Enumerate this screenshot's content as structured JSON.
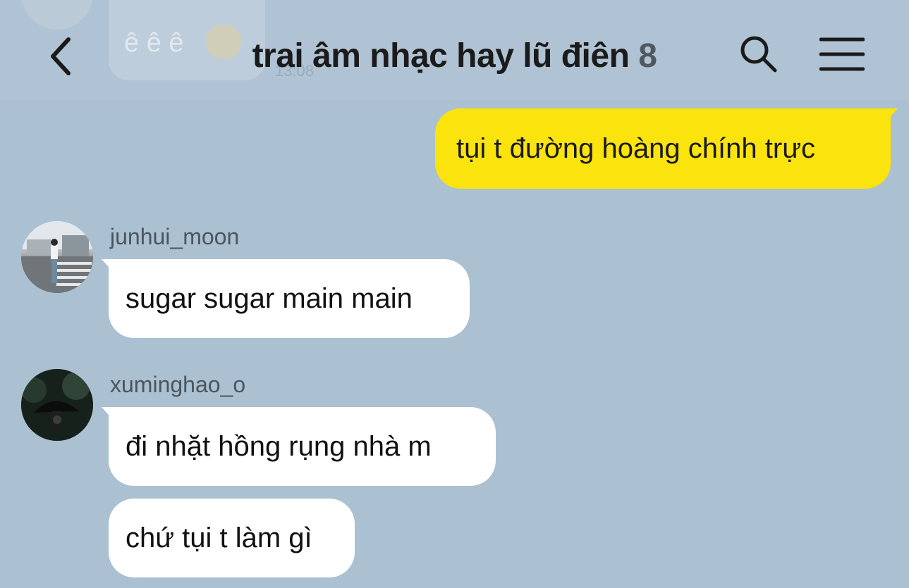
{
  "header": {
    "title": "trai âm nhạc hay lũ điên",
    "member_count": "8",
    "ghost_text": "ê ê ê",
    "ghost_time": "13:08"
  },
  "messages": [
    {
      "id": "m1",
      "side": "mine",
      "text": "tụi t đường hoàng chính trực"
    },
    {
      "id": "m2",
      "side": "other",
      "sender": "junhui_moon",
      "text": "sugar sugar main main"
    },
    {
      "id": "m3",
      "side": "other",
      "sender": "xuminghao_o",
      "text": "đi nhặt hồng rụng nhà m"
    },
    {
      "id": "m4",
      "side": "other",
      "sender": "xuminghao_o",
      "text": "chứ tụi t làm gì"
    }
  ],
  "colors": {
    "background": "#abc1d1",
    "my_bubble": "#fbe30e",
    "other_bubble": "#ffffff"
  },
  "icons": {
    "back": "chevron-left-icon",
    "search": "search-icon",
    "menu": "hamburger-menu-icon"
  }
}
